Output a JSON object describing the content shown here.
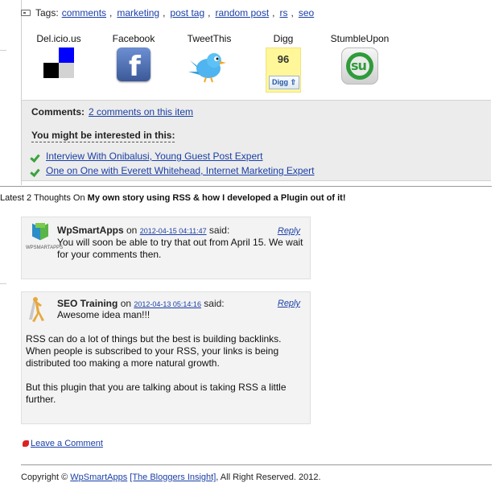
{
  "tags": {
    "label": "Tags:",
    "items": [
      "comments",
      "marketing",
      "post tag",
      "random post",
      "rs",
      "seo"
    ]
  },
  "share": {
    "delicious": "Del.icio.us",
    "facebook": "Facebook",
    "tweetthis": "TweetThis",
    "digg": "Digg",
    "digg_count": "96",
    "digg_button": "Digg",
    "stumbleupon": "StumbleUpon"
  },
  "comments_box": {
    "label": "Comments:",
    "link": "2 comments on this item",
    "interest_heading": "You might be interested in this:",
    "related": [
      "Interview With Onibalusi, Young Guest Post Expert",
      "One on One with Everett Whitehead, Internet Marketing Expert"
    ]
  },
  "thoughts": {
    "prefix": "Latest 2 Thoughts On ",
    "title": "My own story using RSS & how I developed a Plugin out of it!"
  },
  "comments": [
    {
      "author": "WpSmartApps",
      "on": " on ",
      "date": "2012-04-15 04:11:47",
      "said": " said:",
      "reply": "Reply",
      "avatar_caption": "WPSMARTAPPS",
      "body": "You will soon be able to try that out from April 15. We wait for your comments then."
    },
    {
      "author": "SEO Training",
      "on": " on ",
      "date": "2012-04-13 05:14:16",
      "said": " said:",
      "reply": "Reply",
      "body_first": "Awesome idea man!!!",
      "body_p1": "RSS can do a lot of things but the best is building backlinks. When people is subscribed to your RSS, your links is being distributed too making a more natural growth.",
      "body_p2": "But this plugin that you are talking about is taking RSS a little further."
    }
  ],
  "leave_comment": "Leave a Comment",
  "footer": {
    "copyright": "Copyright © ",
    "site": "WpSmartApps",
    "mid": " ",
    "brand": "[The Bloggers Insight]",
    "rest": ", All Right Reserved. 2012."
  },
  "colors": {
    "link": "#1a3fa6",
    "box_bg": "#ececec",
    "card_bg": "#f3f3f3",
    "digg_bg": "#fff799"
  }
}
